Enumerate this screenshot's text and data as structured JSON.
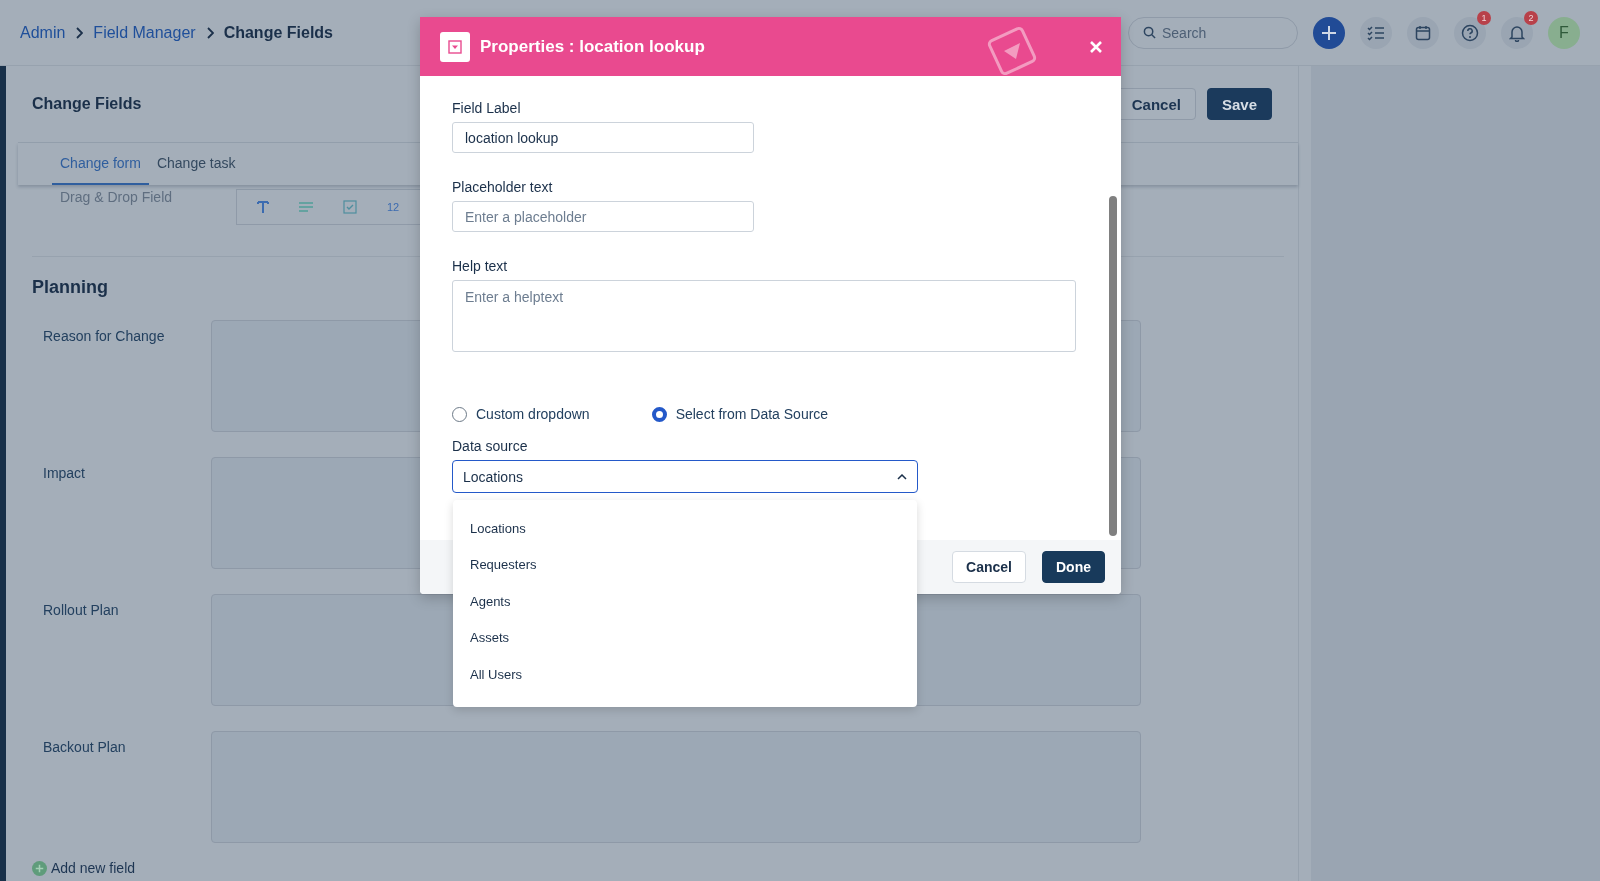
{
  "breadcrumb": [
    {
      "label": "Admin",
      "link": true
    },
    {
      "label": "Field Manager",
      "link": true
    },
    {
      "label": "Change Fields",
      "link": false
    }
  ],
  "search": {
    "placeholder": "Search"
  },
  "header_badges": {
    "help": "1",
    "notifications": "2",
    "avatar": "F"
  },
  "page": {
    "title": "Change Fields",
    "buttons": [
      "Cancel",
      "Save"
    ],
    "tabs": [
      {
        "label": "Change form",
        "selected": true
      },
      {
        "label": "Change task",
        "selected": false
      }
    ],
    "toolbar": {
      "label": "Drag & Drop Field",
      "item_text": "12"
    },
    "section": "Planning",
    "fields": [
      "Reason for Change",
      "Impact",
      "Rollout Plan",
      "Backout Plan"
    ],
    "add_field": "Add new field"
  },
  "modal": {
    "title": "Properties : location lookup",
    "field_label": {
      "label": "Field Label",
      "value": "location lookup"
    },
    "placeholder_text": {
      "label": "Placeholder text",
      "placeholder": "Enter a placeholder"
    },
    "help_text": {
      "label": "Help text",
      "placeholder": "Enter a helptext"
    },
    "options": [
      {
        "label": "Custom dropdown",
        "selected": false
      },
      {
        "label": "Select from Data Source",
        "selected": true
      }
    ],
    "data_source": {
      "label": "Data source",
      "value": "Locations",
      "expanded": true,
      "options": [
        "Locations",
        "Requesters",
        "Agents",
        "Assets",
        "All Users"
      ]
    },
    "buttons": [
      "Cancel",
      "Done"
    ]
  }
}
